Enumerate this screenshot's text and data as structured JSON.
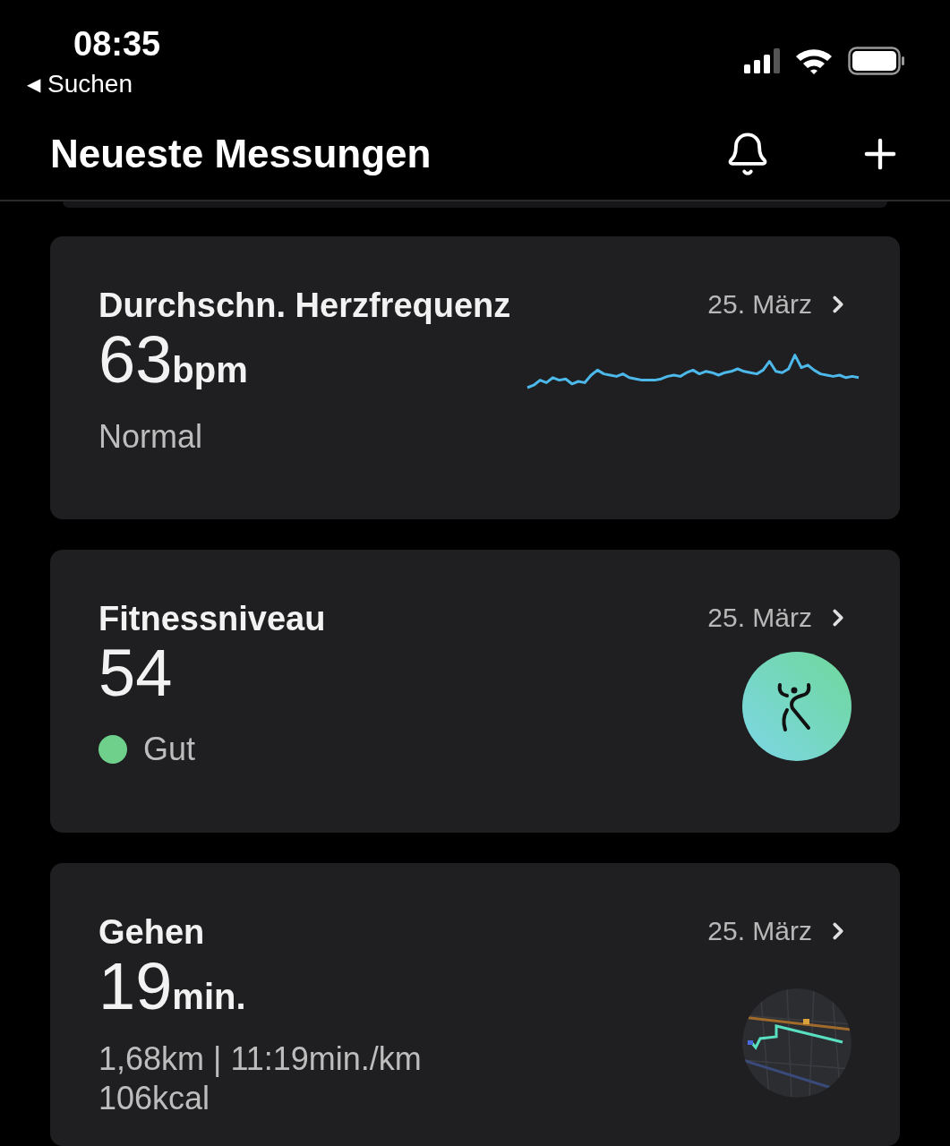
{
  "status_bar": {
    "time": "08:35",
    "back_arrow": "◀",
    "back_label": "Suchen"
  },
  "header": {
    "title": "Neueste Messungen"
  },
  "cards": [
    {
      "kind": "sparkline",
      "title": "Durchschn. Herzfrequenz",
      "date": "25. März",
      "value": "63",
      "unit": "bpm",
      "status": "Normal"
    },
    {
      "kind": "status_dot",
      "title": "Fitnessniveau",
      "date": "25. März",
      "value": "54",
      "status": "Gut",
      "color": "#6fd08c"
    },
    {
      "kind": "map",
      "title": "Gehen",
      "date": "25. März",
      "value": "19",
      "unit": "min.",
      "details": [
        "1,68km | 11:19min./km",
        "106kcal"
      ]
    }
  ]
}
